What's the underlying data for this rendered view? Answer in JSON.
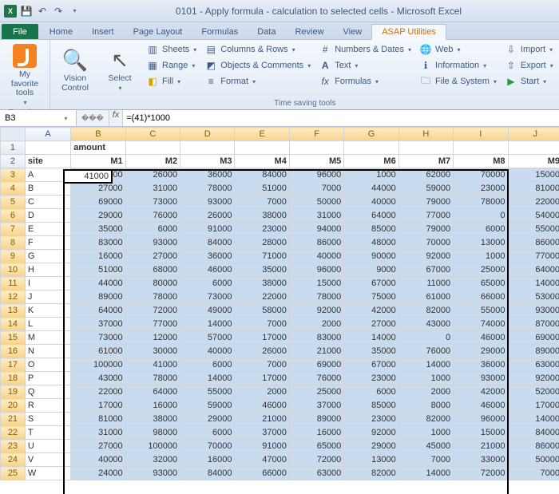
{
  "titlebar": {
    "app": "Microsoft Excel",
    "doc": "0101 - Apply formula - calculation to selected cells",
    "full": "0101 - Apply formula - calculation to selected cells  -  Microsoft Excel"
  },
  "ribbon_tabs": {
    "file": "File",
    "items": [
      "Home",
      "Insert",
      "Page Layout",
      "Formulas",
      "Data",
      "Review",
      "View",
      "ASAP Utilities"
    ],
    "active": "ASAP Utilities"
  },
  "ribbon": {
    "fav": {
      "label": "My favorite tools",
      "group": "Favorites"
    },
    "vision": "Vision Control",
    "select": "Select",
    "col1": {
      "sheets": "Sheets",
      "range": "Range",
      "fill": "Fill"
    },
    "col2": {
      "colsrows": "Columns & Rows",
      "objects": "Objects & Comments",
      "format": "Format"
    },
    "col3": {
      "numdate": "Numbers & Dates",
      "text": "Text",
      "formulas": "Formulas"
    },
    "col4": {
      "web": "Web",
      "info": "Information",
      "filesys": "File & System"
    },
    "col5": {
      "import": "Import",
      "export": "Export",
      "start": "Start"
    },
    "group2": "Time saving tools"
  },
  "namebox": "B3",
  "formula": "=(41)*1000",
  "columns": [
    "A",
    "B",
    "C",
    "D",
    "E",
    "F",
    "G",
    "H",
    "I",
    "J"
  ],
  "header_row": {
    "site": "site",
    "amount": "amount",
    "months": [
      "M1",
      "M2",
      "M3",
      "M4",
      "M5",
      "M6",
      "M7",
      "M8",
      "M9"
    ]
  },
  "rows": [
    {
      "n": 3,
      "site": "A",
      "v": [
        41000,
        26000,
        36000,
        84000,
        96000,
        1000,
        62000,
        70000,
        15000
      ]
    },
    {
      "n": 4,
      "site": "B",
      "v": [
        27000,
        31000,
        78000,
        51000,
        7000,
        44000,
        59000,
        23000,
        81000
      ]
    },
    {
      "n": 5,
      "site": "C",
      "v": [
        69000,
        73000,
        93000,
        7000,
        50000,
        40000,
        79000,
        78000,
        22000
      ]
    },
    {
      "n": 6,
      "site": "D",
      "v": [
        29000,
        76000,
        26000,
        38000,
        31000,
        64000,
        77000,
        0,
        54000
      ]
    },
    {
      "n": 7,
      "site": "E",
      "v": [
        35000,
        6000,
        91000,
        23000,
        94000,
        85000,
        79000,
        6000,
        55000
      ]
    },
    {
      "n": 8,
      "site": "F",
      "v": [
        83000,
        93000,
        84000,
        28000,
        86000,
        48000,
        70000,
        13000,
        86000
      ]
    },
    {
      "n": 9,
      "site": "G",
      "v": [
        16000,
        27000,
        36000,
        71000,
        40000,
        90000,
        92000,
        1000,
        77000
      ]
    },
    {
      "n": 10,
      "site": "H",
      "v": [
        51000,
        68000,
        46000,
        35000,
        96000,
        9000,
        67000,
        25000,
        64000
      ]
    },
    {
      "n": 11,
      "site": "I",
      "v": [
        44000,
        80000,
        6000,
        38000,
        15000,
        67000,
        11000,
        65000,
        14000
      ]
    },
    {
      "n": 12,
      "site": "J",
      "v": [
        89000,
        78000,
        73000,
        22000,
        78000,
        75000,
        61000,
        66000,
        53000
      ]
    },
    {
      "n": 13,
      "site": "K",
      "v": [
        64000,
        72000,
        49000,
        58000,
        92000,
        42000,
        82000,
        55000,
        93000
      ]
    },
    {
      "n": 14,
      "site": "L",
      "v": [
        37000,
        77000,
        14000,
        7000,
        2000,
        27000,
        43000,
        74000,
        87000
      ]
    },
    {
      "n": 15,
      "site": "M",
      "v": [
        73000,
        12000,
        57000,
        17000,
        83000,
        14000,
        0,
        46000,
        69000
      ]
    },
    {
      "n": 16,
      "site": "N",
      "v": [
        61000,
        30000,
        40000,
        26000,
        21000,
        35000,
        76000,
        29000,
        89000
      ]
    },
    {
      "n": 17,
      "site": "O",
      "v": [
        100000,
        41000,
        6000,
        7000,
        69000,
        67000,
        14000,
        36000,
        63000
      ]
    },
    {
      "n": 18,
      "site": "P",
      "v": [
        43000,
        78000,
        14000,
        17000,
        76000,
        23000,
        1000,
        93000,
        92000
      ]
    },
    {
      "n": 19,
      "site": "Q",
      "v": [
        22000,
        64000,
        55000,
        2000,
        25000,
        6000,
        2000,
        42000,
        52000
      ]
    },
    {
      "n": 20,
      "site": "R",
      "v": [
        17000,
        16000,
        59000,
        46000,
        37000,
        85000,
        8000,
        46000,
        17000
      ]
    },
    {
      "n": 21,
      "site": "S",
      "v": [
        81000,
        38000,
        29000,
        21000,
        89000,
        23000,
        82000,
        96000,
        14000
      ]
    },
    {
      "n": 22,
      "site": "T",
      "v": [
        31000,
        98000,
        6000,
        37000,
        16000,
        92000,
        1000,
        15000,
        84000
      ]
    },
    {
      "n": 23,
      "site": "U",
      "v": [
        27000,
        100000,
        70000,
        91000,
        65000,
        29000,
        45000,
        21000,
        86000
      ]
    },
    {
      "n": 24,
      "site": "V",
      "v": [
        40000,
        32000,
        16000,
        47000,
        72000,
        13000,
        7000,
        33000,
        50000
      ]
    },
    {
      "n": 25,
      "site": "W",
      "v": [
        24000,
        93000,
        84000,
        66000,
        63000,
        82000,
        14000,
        72000,
        7000
      ]
    }
  ]
}
